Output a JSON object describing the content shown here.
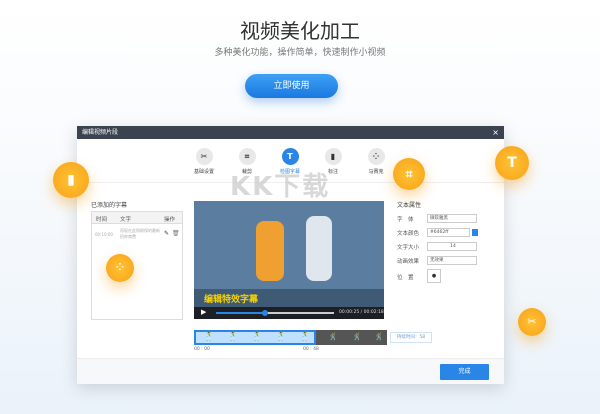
{
  "hero": {
    "title": "视频美化加工",
    "subtitle": "多种美化功能，操作简单，快速制作小视频",
    "cta": "立即使用"
  },
  "dialog": {
    "title": "编辑视频片段",
    "close": "×",
    "tools": [
      {
        "label": "基础设置",
        "icon": "scissors-icon",
        "glyph": "✂"
      },
      {
        "label": "裁剪",
        "icon": "crop-icon",
        "glyph": "⌗"
      },
      {
        "label": "检图字幕",
        "icon": "text-icon",
        "glyph": "T"
      },
      {
        "label": "标注",
        "icon": "bookmark-icon",
        "glyph": "▮"
      },
      {
        "label": "马赛克",
        "icon": "mosaic-icon",
        "glyph": "⁘"
      }
    ],
    "subtitles": {
      "heading": "已添加的字幕",
      "columns": [
        "时间",
        "文字",
        "操作"
      ],
      "rows": [
        {
          "time": "00:10:00",
          "text": "而现在此照刷保的最新招库商费"
        }
      ]
    },
    "video": {
      "caption": "编辑特效字幕",
      "time": "00:00:25 / 00:02:18"
    },
    "timeline": {
      "start": "00 : 00",
      "mark": "00 : 48",
      "duration": "持续时间：58"
    },
    "props": {
      "heading": "文本属性",
      "font_label": "字　体",
      "font_value": "微软雅黑",
      "color_label": "文本颜色",
      "color_value": "#6462ff",
      "size_label": "文字大小",
      "size_value": "14",
      "anim_label": "动画效果",
      "anim_value": "无效果",
      "pos_label": "位　置"
    },
    "done": "完成"
  },
  "watermark": "KK下载",
  "accent": "#2a86e6"
}
